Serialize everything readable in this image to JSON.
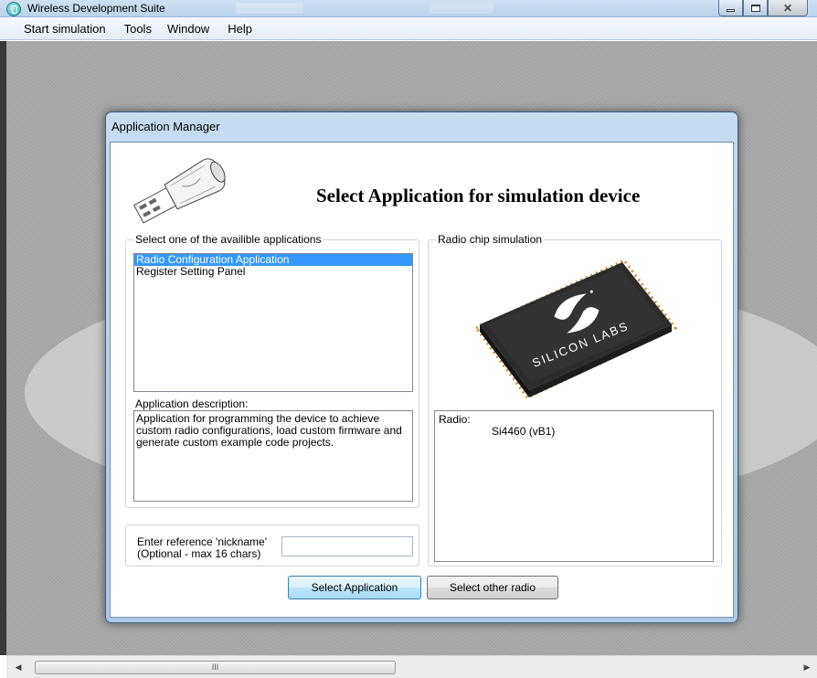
{
  "window": {
    "title": "Wireless Development Suite"
  },
  "menu": {
    "items": [
      {
        "label": "Start simulation"
      },
      {
        "label": "Tools"
      },
      {
        "label": "Window"
      },
      {
        "label": "Help"
      }
    ]
  },
  "dialog": {
    "title": "Application Manager",
    "heading": "Select Application for simulation device",
    "applications": {
      "caption": "Select one of the availible applications",
      "items": [
        {
          "label": "Radio Configuration Application",
          "selected": true
        },
        {
          "label": "Register Setting Panel",
          "selected": false
        }
      ],
      "description_label": "Application description:",
      "description": "Application for programming the device to achieve custom radio configurations, load custom firmware and generate custom example code projects."
    },
    "radio": {
      "caption": "Radio chip simulation",
      "chip_brand": "SILICON LABS",
      "label": "Radio:",
      "value": "Si4460 (vB1)"
    },
    "nickname": {
      "label": "Enter reference 'nickname'\n(Optional - max 16 chars)",
      "value": ""
    },
    "buttons": {
      "select_application": "Select Application",
      "select_other_radio": "Select other radio"
    }
  },
  "scrollbar": {
    "thumb_grip": "III"
  },
  "icons": {
    "app": "wireless-app-icon",
    "usb": "usb-stick-icon",
    "chip": "silicon-labs-chip-icon"
  },
  "colors": {
    "selection": "#3399ff",
    "titlebar": "#b9d1ea"
  }
}
